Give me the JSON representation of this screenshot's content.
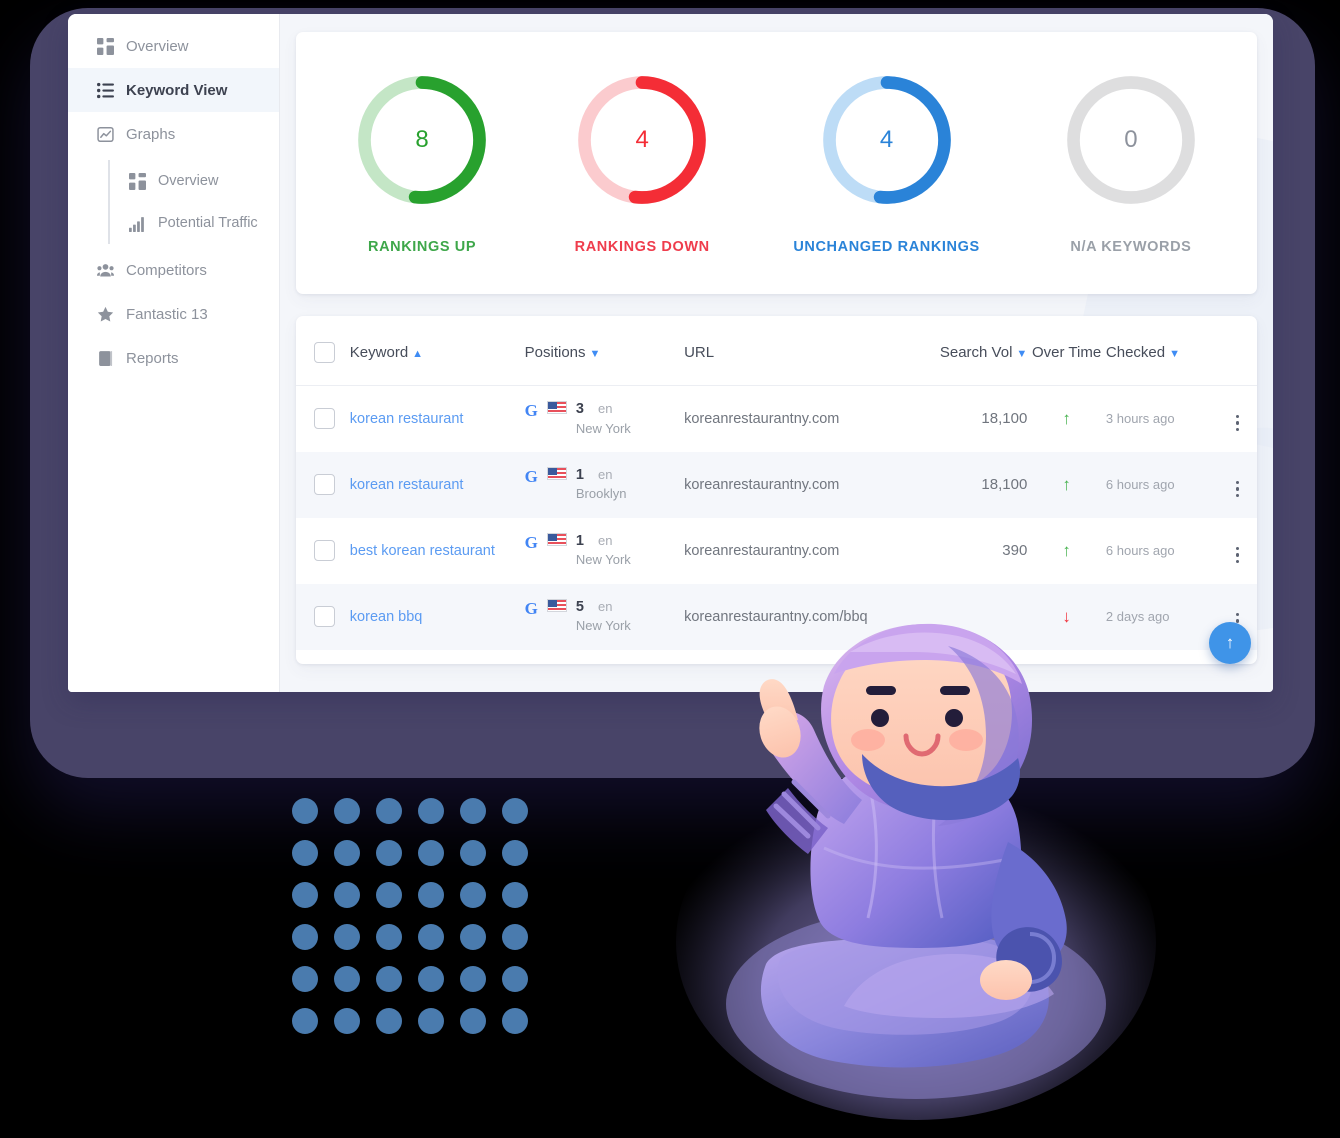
{
  "sidebar": {
    "items": [
      {
        "label": "Overview",
        "icon": "grid-icon",
        "active": false
      },
      {
        "label": "Keyword View",
        "icon": "list-icon",
        "active": true
      },
      {
        "label": "Graphs",
        "icon": "chart-area-icon",
        "active": false
      },
      {
        "label": "Competitors",
        "icon": "users-icon",
        "active": false
      },
      {
        "label": "Fantastic 13",
        "icon": "star-icon",
        "active": false
      },
      {
        "label": "Reports",
        "icon": "book-icon",
        "active": false
      }
    ],
    "sub_items": [
      {
        "label": "Overview",
        "icon": "grid-icon"
      },
      {
        "label": "Potential Traffic",
        "icon": "bars-icon"
      }
    ]
  },
  "stats": [
    {
      "value": "8",
      "label": "RANKINGS UP",
      "color": "#28a12e",
      "track": "#c4e6c6",
      "percent": 52
    },
    {
      "value": "4",
      "label": "RANKINGS DOWN",
      "color": "#f42d36",
      "track": "#fbcbce",
      "percent": 52
    },
    {
      "value": "4",
      "label": "UNCHANGED RANKINGS",
      "color": "#2a83d8",
      "track": "#bddcf6",
      "percent": 52
    },
    {
      "value": "0",
      "label": "N/A KEYWORDS",
      "color": "#dededf",
      "track": "#dededf",
      "percent": 0
    }
  ],
  "table": {
    "columns": [
      {
        "label": "Keyword",
        "sort": "asc"
      },
      {
        "label": "Positions",
        "sort": "desc"
      },
      {
        "label": "URL",
        "sort": ""
      },
      {
        "label": "Search Vol",
        "sort": "desc"
      },
      {
        "label": "Over Time",
        "sort": ""
      },
      {
        "label": "Checked",
        "sort": "desc"
      }
    ],
    "rows": [
      {
        "keyword": "korean restaurant",
        "engine": "G",
        "position": "3",
        "lang": "en",
        "city": "New York",
        "url": "koreanrestaurantny.com",
        "volume": "18,100",
        "trend": "up",
        "trend_glyph": "↑",
        "checked": "3 hours ago"
      },
      {
        "keyword": "korean restaurant",
        "engine": "G",
        "position": "1",
        "lang": "en",
        "city": "Brooklyn",
        "url": "koreanrestaurantny.com",
        "volume": "18,100",
        "trend": "up",
        "trend_glyph": "↑",
        "checked": "6 hours ago"
      },
      {
        "keyword": "best korean restaurant",
        "engine": "G",
        "position": "1",
        "lang": "en",
        "city": "New York",
        "url": "koreanrestaurantny.com",
        "volume": "390",
        "trend": "up",
        "trend_glyph": "↑",
        "checked": "6 hours ago"
      },
      {
        "keyword": "korean bbq",
        "engine": "G",
        "position": "5",
        "lang": "en",
        "city": "New York",
        "url": "koreanrestaurantny.com/bbq",
        "volume": "",
        "trend": "down",
        "trend_glyph": "↓",
        "checked": "2 days ago"
      }
    ]
  },
  "fab": {
    "glyph": "↑",
    "name": "scroll-to-top"
  },
  "colors": {
    "frame_purple": "#484468",
    "app_bg": "#f4f6fa",
    "accent_blue": "#3f94e8",
    "link_blue": "#5b9bf2",
    "dot_blue": "#4a7bae"
  }
}
